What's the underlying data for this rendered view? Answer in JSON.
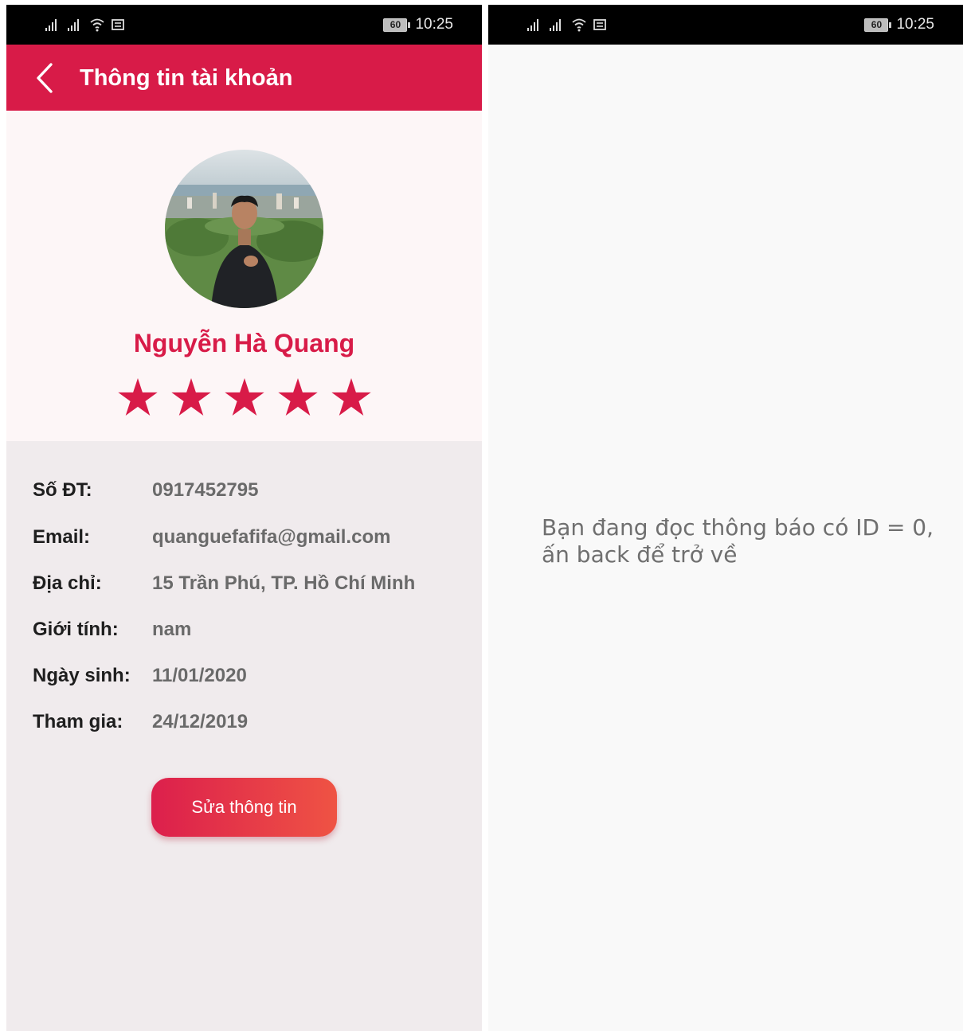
{
  "left_screen": {
    "status_bar": {
      "battery": "60",
      "time": "10:25"
    },
    "app_bar": {
      "title": "Thông tin tài khoản"
    },
    "profile": {
      "name": "Nguyễn Hà Quang",
      "rating": 5,
      "rating_max": 5
    },
    "info": {
      "rows": [
        {
          "label": "Số ĐT:",
          "value": "0917452795"
        },
        {
          "label": "Email:",
          "value": "quanguefafifa@gmail.com"
        },
        {
          "label": "Địa chỉ:",
          "value": "15 Trần Phú, TP. Hồ Chí Minh"
        },
        {
          "label": "Giới tính:",
          "value": "nam"
        },
        {
          "label": "Ngày sinh:",
          "value": "11/01/2020"
        },
        {
          "label": "Tham gia:",
          "value": "24/12/2019"
        }
      ]
    },
    "edit_button_label": "Sửa thông tin"
  },
  "right_screen": {
    "status_bar": {
      "battery": "60",
      "time": "10:25"
    },
    "notice": {
      "line1": "Bạn đang đọc thông báo có ID = 0,",
      "line2": "ấn back để trở về"
    }
  },
  "colors": {
    "primary": "#d81b48",
    "accent_gradient_end": "#ef5344",
    "info_background": "#f0ebed",
    "profile_background": "#fdf6f7"
  },
  "icons": [
    "signal-icon",
    "wifi-icon",
    "message-icon",
    "battery-icon",
    "back-arrow-icon",
    "star-icon"
  ]
}
